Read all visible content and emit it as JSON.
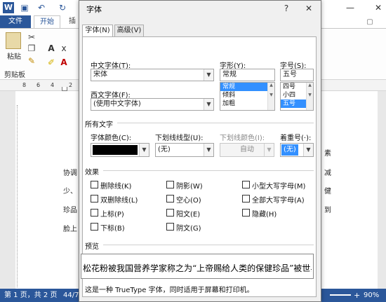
{
  "word": {
    "logo": "W",
    "tabs": {
      "file": "文件",
      "home": "开始",
      "insert": "插"
    },
    "ribbon": {
      "paste": "粘贴",
      "clipboard": "剪贴板"
    },
    "ruler_marks": [
      "8",
      "6",
      "4",
      "2"
    ],
    "doc_lines_left": [
      "协调",
      "少、",
      "珍品",
      "脸上"
    ],
    "doc_lines_right": [
      "素",
      "减",
      "健",
      "到"
    ],
    "status": {
      "page": "第 1 页，共 2 页",
      "words": "44/7",
      "zoom": "90%"
    },
    "status_plus": "+"
  },
  "dialog": {
    "title": "字体",
    "help": "?",
    "close": "✕",
    "tabs": [
      {
        "label": "字体(N)"
      },
      {
        "label": "高级(V)"
      }
    ],
    "chinese_font": {
      "label": "中文字体(T):",
      "value": "宋体"
    },
    "western_font": {
      "label": "西文字体(F):",
      "value": "(使用中文字体)"
    },
    "style": {
      "label": "字形(Y):",
      "value": "常规",
      "options": [
        "常规",
        "倾斜",
        "加粗"
      ],
      "selected": "常规"
    },
    "size": {
      "label": "字号(S):",
      "value": "五号",
      "options": [
        "四号",
        "小四",
        "五号"
      ],
      "selected": "五号"
    },
    "all_text": "所有文字",
    "font_color": {
      "label": "字体颜色(C):",
      "color": "#000000"
    },
    "underline_style": {
      "label": "下划线线型(U):",
      "value": "(无)"
    },
    "underline_color": {
      "label": "下划线颜色(I):",
      "value": "自动"
    },
    "emphasis": {
      "label": "着重号(·):",
      "value": "(无)"
    },
    "effects_title": "效果",
    "effects": [
      {
        "label": "删除线(K)"
      },
      {
        "label": "阴影(W)"
      },
      {
        "label": "小型大写字母(M)"
      },
      {
        "label": "双删除线(L)"
      },
      {
        "label": "空心(O)"
      },
      {
        "label": "全部大写字母(A)"
      },
      {
        "label": "上标(P)"
      },
      {
        "label": "阳文(E)"
      },
      {
        "label": "隐藏(H)"
      },
      {
        "label": "下标(B)"
      },
      {
        "label": "阴文(G)"
      }
    ],
    "preview_title": "预览",
    "preview_text": "松花粉被我国营养学家称之为“上帝赐给人类的保健珍品”被世界称为",
    "footnote": "这是一种 TrueType 字体，同时适用于屏幕和打印机。"
  },
  "colors": {
    "accent": "#2b579a",
    "selection": "#3390ff"
  }
}
